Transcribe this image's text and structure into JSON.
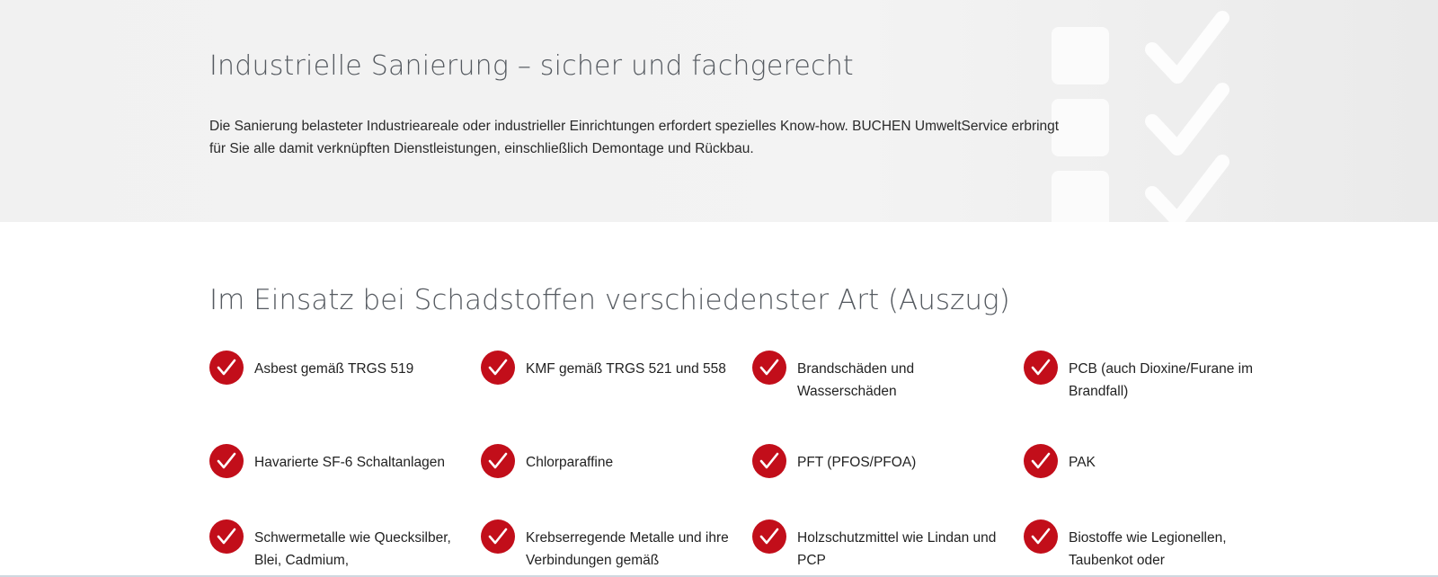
{
  "hero": {
    "title": "Industrielle Sanierung – sicher und fachgerecht",
    "text": "Die Sanierung belasteter Industrieareale oder industrieller Einrichtungen erfordert spezielles Know-how. BUCHEN UmweltService erbringt für Sie alle damit verknüpften Dienstleistungen, einschließlich Demontage und Rückbau.",
    "decoration_icon": "checklist-icon"
  },
  "section": {
    "title": "Im Einsatz bei Schadstoffen verschiedenster Art (Auszug)",
    "check_icon": "checkmark-circle-icon",
    "accent_color": "#c20e1a",
    "items": [
      {
        "label": "Asbest gemäß TRGS 519"
      },
      {
        "label": "KMF gemäß TRGS 521 und 558"
      },
      {
        "label": "Brandschäden und Wasserschäden"
      },
      {
        "label": "PCB (auch Dioxine/Furane im Brandfall)"
      },
      {
        "label": "Havarierte SF-6 Schaltanlagen"
      },
      {
        "label": "Chlorparaffine"
      },
      {
        "label": "PFT (PFOS/PFOA)"
      },
      {
        "label": "PAK"
      },
      {
        "label": "Schwermetalle wie Quecksilber, Blei, Cadmium,"
      },
      {
        "label": "Krebserregende Metalle und ihre Verbindungen gemäß"
      },
      {
        "label": "Holzschutzmittel wie Lindan und PCP"
      },
      {
        "label": "Biostoffe wie Legionellen, Taubenkot oder"
      }
    ]
  }
}
